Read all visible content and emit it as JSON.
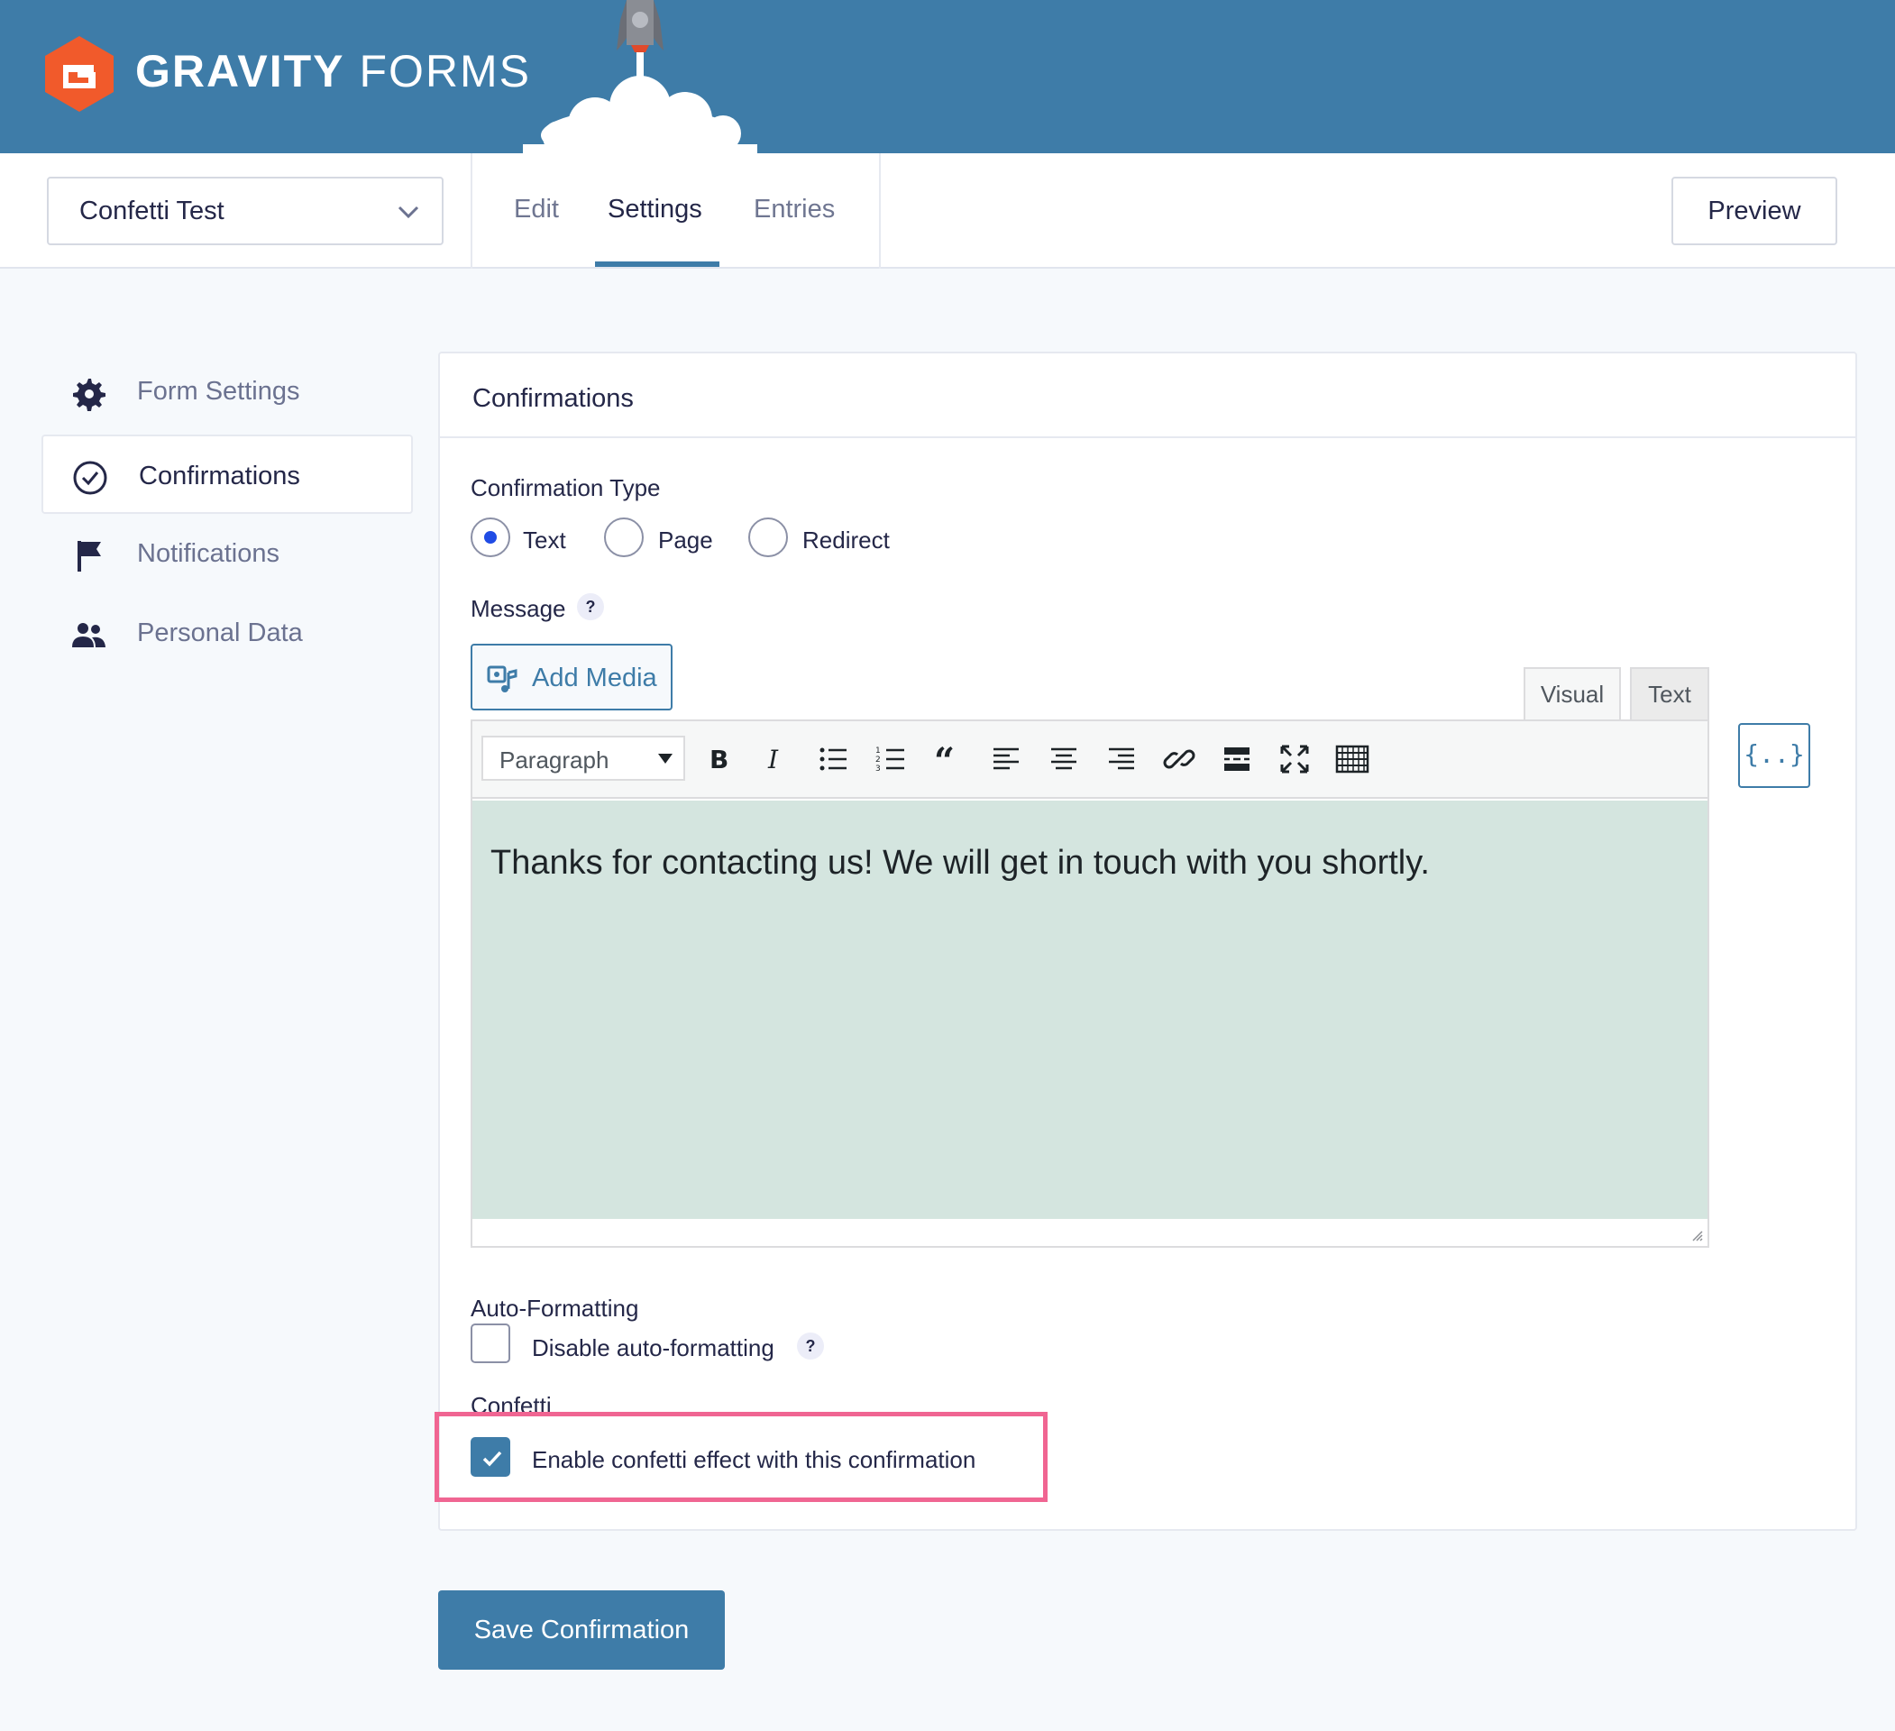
{
  "brand": {
    "name_bold": "GRAVITY",
    "name_light": "FORMS"
  },
  "form_selector": {
    "value": "Confetti Test"
  },
  "tabs": [
    {
      "label": "Edit"
    },
    {
      "label": "Settings"
    },
    {
      "label": "Entries"
    }
  ],
  "active_tab": "Settings",
  "preview_label": "Preview",
  "sidebar": {
    "items": [
      {
        "label": "Form Settings",
        "icon": "gear-icon"
      },
      {
        "label": "Confirmations",
        "icon": "check-circle-icon"
      },
      {
        "label": "Notifications",
        "icon": "flag-icon"
      },
      {
        "label": "Personal Data",
        "icon": "users-icon"
      }
    ],
    "active": "Confirmations"
  },
  "panel": {
    "title": "Confirmations",
    "confirmation_type": {
      "label": "Confirmation Type",
      "options": [
        "Text",
        "Page",
        "Redirect"
      ],
      "selected": "Text"
    },
    "message": {
      "label": "Message",
      "help": "?",
      "add_media_label": "Add Media",
      "editor_tabs": [
        "Visual",
        "Text"
      ],
      "active_editor_tab": "Visual",
      "format_select": "Paragraph",
      "toolbar_icons": [
        "bold-icon",
        "italic-icon",
        "bullet-list-icon",
        "numbered-list-icon",
        "blockquote-icon",
        "align-left-icon",
        "align-center-icon",
        "align-right-icon",
        "link-icon",
        "read-more-icon",
        "fullscreen-icon",
        "toolbar-toggle-icon"
      ],
      "content": "Thanks for contacting us! We will get in touch with you shortly.",
      "merge_tag_label": "{..}"
    },
    "auto_formatting": {
      "label": "Auto-Formatting",
      "checkbox_label": "Disable auto-formatting",
      "help": "?",
      "checked": false
    },
    "confetti": {
      "label": "Confetti",
      "checkbox_label": "Enable confetti effect with this confirmation",
      "checked": true
    }
  },
  "save_label": "Save Confirmation",
  "colors": {
    "header": "#3e7ca8",
    "accent": "#3e7ca8",
    "logo": "#f15a2b",
    "highlight": "#f06592",
    "editor_bg": "#d4e5df"
  }
}
